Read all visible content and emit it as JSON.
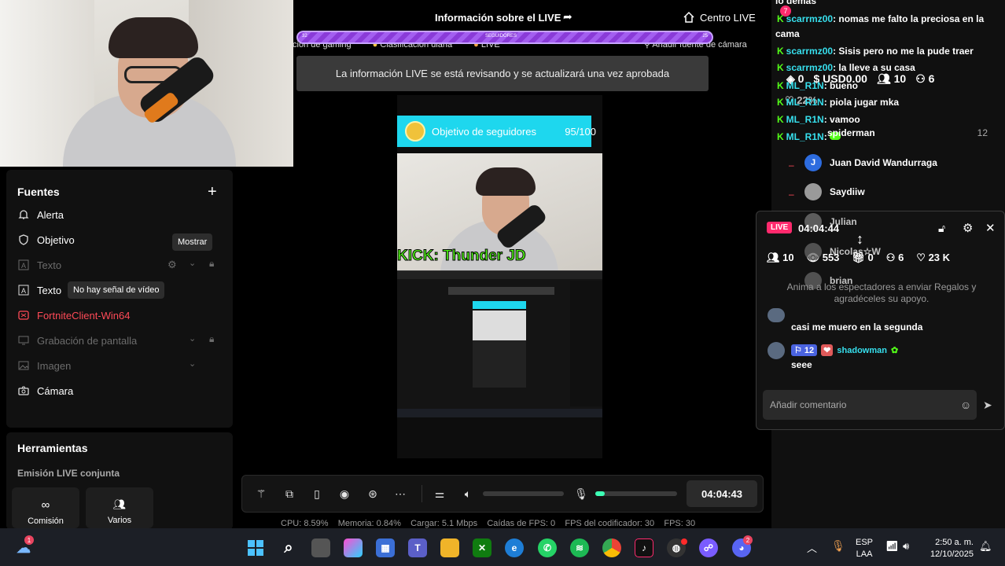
{
  "header": {
    "title": "Información sobre el LIVE",
    "center_live": "Centro LIVE"
  },
  "goal_bar": {
    "label": "SEGUIDORES",
    "left_num": "32",
    "right_num": "25"
  },
  "subtoolbar": {
    "items": [
      "ción de gaming",
      "Clasificación diaria",
      "LIVE",
      "Añadir fuente de cámara"
    ]
  },
  "review_banner": "La información LIVE se está revisando y se actualizará una vez aprobada",
  "preview": {
    "goal_label": "Objetivo de seguidores",
    "goal_count": "95/100",
    "kick_text": "KICK: Thunder JD"
  },
  "sources": {
    "title": "Fuentes",
    "items": [
      {
        "label": "Alerta",
        "icon": "bell-icon"
      },
      {
        "label": "Objetivo",
        "icon": "shield-icon"
      },
      {
        "label": "Texto",
        "icon": "text-icon"
      },
      {
        "label": "Texto",
        "icon": "text-icon"
      },
      {
        "label": "FortniteClient-Win64",
        "icon": "game-icon"
      },
      {
        "label": "Grabación de pantalla",
        "icon": "screen-icon"
      },
      {
        "label": "Imagen",
        "icon": "image-icon"
      },
      {
        "label": "Cámara",
        "icon": "camera-icon"
      }
    ],
    "tooltip_show": "Mostrar",
    "tooltip_nosignal": "No hay señal de vídeo"
  },
  "tools": {
    "title": "Herramientas",
    "subtitle": "Emisión LIVE conjunta",
    "cards": [
      "Comisión",
      "Varios"
    ]
  },
  "controls": {
    "timer": "04:04:43",
    "volume": 0,
    "mic": 0.1
  },
  "stats": {
    "cpu": "CPU: 8.59%",
    "mem": "Memoria: 0.84%",
    "upload": "Cargar: 5.1 Mbps",
    "fps_drops": "Caídas de FPS: 0",
    "encoder": "FPS del codificador: 30",
    "fps": "FPS: 30"
  },
  "chat": {
    "top_partial": "lo demás",
    "lines": [
      {
        "user": "scarrmz00",
        "msg": ": nomas me falto la preciosa en la"
      },
      {
        "user": "",
        "msg": "cama"
      },
      {
        "user": "scarrmz00",
        "msg": ": Sisis pero no me la pude traer"
      },
      {
        "user": "scarrmz00",
        "msg": ": la lleve a su casa"
      },
      {
        "user": "ML_R1N",
        "msg": ": bueno"
      },
      {
        "user": "ML_R1N",
        "msg": ": piola jugar mka"
      },
      {
        "user": "ML_R1N",
        "msg": ": vamoo"
      },
      {
        "user": "ML_R1N",
        "msg": ":"
      }
    ],
    "badge_count": "7"
  },
  "live_stats": {
    "gems": "0",
    "usd": "USD0.00",
    "viewers": "10",
    "followers": "6",
    "percent": "22%"
  },
  "viewers_list": [
    {
      "name": "spiderman",
      "count": "12"
    },
    {
      "name": "Juan David Wandurraga",
      "initial": "J"
    },
    {
      "name": "Saydiiw"
    },
    {
      "name": "Julian"
    },
    {
      "name": "Nicolas☆W"
    },
    {
      "name": "brian"
    }
  ],
  "live_popup": {
    "badge": "LIVE",
    "time": "04:04:44",
    "viewers": "10",
    "views": "553",
    "gifts": "0",
    "followers": "6",
    "likes": "23 K",
    "hint": "Anima a los espectadores a enviar Regalos y agradéceles su apoyo.",
    "comments": [
      {
        "user": "",
        "msg": "casi me muero en la segunda"
      },
      {
        "user": "shadowman",
        "level": "12",
        "msg": "seee"
      }
    ],
    "comment_placeholder": "Añadir comentario"
  },
  "taskbar": {
    "lang": "ESP",
    "lang2": "LAA",
    "time": "2:50 a. m.",
    "date": "12/10/2025",
    "notif": "1",
    "discord_badge": "2"
  }
}
